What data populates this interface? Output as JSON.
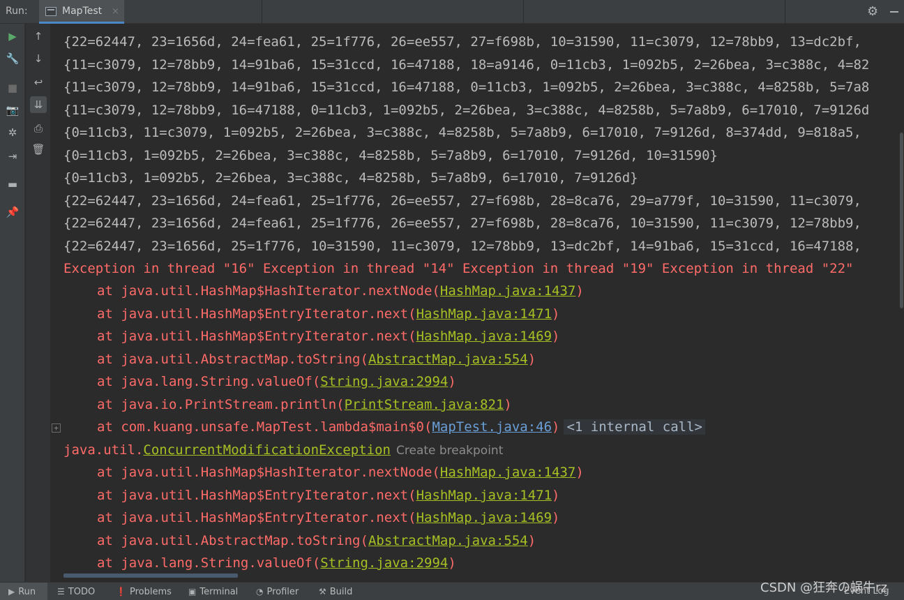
{
  "header": {
    "run_label": "Run:",
    "tab_title": "MapTest",
    "tab_close": "×"
  },
  "console": {
    "output": [
      "{22=62447, 23=1656d, 24=fea61, 25=1f776, 26=ee557, 27=f698b, 10=31590, 11=c3079, 12=78bb9, 13=dc2bf,",
      "{11=c3079, 12=78bb9, 14=91ba6, 15=31ccd, 16=47188, 18=a9146, 0=11cb3, 1=092b5, 2=26bea, 3=c388c, 4=82",
      "{11=c3079, 12=78bb9, 14=91ba6, 15=31ccd, 16=47188, 0=11cb3, 1=092b5, 2=26bea, 3=c388c, 4=8258b, 5=7a8",
      "{11=c3079, 12=78bb9, 16=47188, 0=11cb3, 1=092b5, 2=26bea, 3=c388c, 4=8258b, 5=7a8b9, 6=17010, 7=9126d",
      "{0=11cb3, 11=c3079, 1=092b5, 2=26bea, 3=c388c, 4=8258b, 5=7a8b9, 6=17010, 7=9126d, 8=374dd, 9=818a5,",
      "{0=11cb3, 1=092b5, 2=26bea, 3=c388c, 4=8258b, 5=7a8b9, 6=17010, 7=9126d, 10=31590}",
      "{0=11cb3, 1=092b5, 2=26bea, 3=c388c, 4=8258b, 5=7a8b9, 6=17010, 7=9126d}",
      "{22=62447, 23=1656d, 24=fea61, 25=1f776, 26=ee557, 27=f698b, 28=8ca76, 29=a779f, 10=31590, 11=c3079,",
      "{22=62447, 23=1656d, 24=fea61, 25=1f776, 26=ee557, 27=f698b, 28=8ca76, 10=31590, 11=c3079, 12=78bb9,",
      "{22=62447, 23=1656d, 25=1f776, 10=31590, 11=c3079, 12=78bb9, 13=dc2bf, 14=91ba6, 15=31ccd, 16=47188,"
    ],
    "exception_line": "Exception in thread \"16\" Exception in thread \"14\" Exception in thread \"19\" Exception in thread \"22\"",
    "trace1": [
      {
        "text": "at java.util.HashMap$HashIterator.nextNode(",
        "link": "HashMap.java:1437",
        "end": ")"
      },
      {
        "text": "at java.util.HashMap$EntryIterator.next(",
        "link": "HashMap.java:1471",
        "end": ")"
      },
      {
        "text": "at java.util.HashMap$EntryIterator.next(",
        "link": "HashMap.java:1469",
        "end": ")"
      },
      {
        "text": "at java.util.AbstractMap.toString(",
        "link": "AbstractMap.java:554",
        "end": ")"
      },
      {
        "text": "at java.lang.String.valueOf(",
        "link": "String.java:2994",
        "end": ")"
      },
      {
        "text": "at java.io.PrintStream.println(",
        "link": "PrintStream.java:821",
        "end": ")"
      }
    ],
    "lambda_line": {
      "text": "at com.kuang.unsafe.MapTest.lambda$main$0(",
      "link": "MapTest.java:46",
      "end": ")",
      "hint": "<1 internal call>"
    },
    "expander": "+",
    "exception2": {
      "prefix": "java.util.",
      "link": "ConcurrentModificationException",
      "tip": "Create breakpoint"
    },
    "trace2": [
      {
        "text": "at java.util.HashMap$HashIterator.nextNode(",
        "link": "HashMap.java:1437",
        "end": ")"
      },
      {
        "text": "at java.util.HashMap$EntryIterator.next(",
        "link": "HashMap.java:1471",
        "end": ")"
      },
      {
        "text": "at java.util.HashMap$EntryIterator.next(",
        "link": "HashMap.java:1469",
        "end": ")"
      },
      {
        "text": "at java.util.AbstractMap.toString(",
        "link": "AbstractMap.java:554",
        "end": ")"
      },
      {
        "text": "at java.lang.String.valueOf(",
        "link": "String.java:2994",
        "end": ")"
      }
    ]
  },
  "gutter_icons": {
    "main": [
      "run-icon",
      "wrench-icon",
      "stop-icon",
      "camera-icon",
      "bug-icon",
      "exit-icon",
      "layout-icon",
      "pin-icon"
    ],
    "secondary": [
      "up-arrow-icon",
      "down-arrow-icon",
      "soft-wrap-icon",
      "scroll-to-end-icon",
      "print-icon",
      "trash-icon"
    ]
  },
  "bottom_bar": {
    "run": "Run",
    "todo": "TODO",
    "problems": "Problems",
    "terminal": "Terminal",
    "profiler": "Profiler",
    "build": "Build",
    "event_log": "Event Log"
  },
  "watermark": "CSDN @狂奔の蜗牛rz",
  "colors": {
    "background": "#2b2b2b",
    "error_text": "#ff6b68",
    "link_blue": "#6a9fd8",
    "link_yellow": "#a8c023",
    "run_green": "#59a869"
  }
}
